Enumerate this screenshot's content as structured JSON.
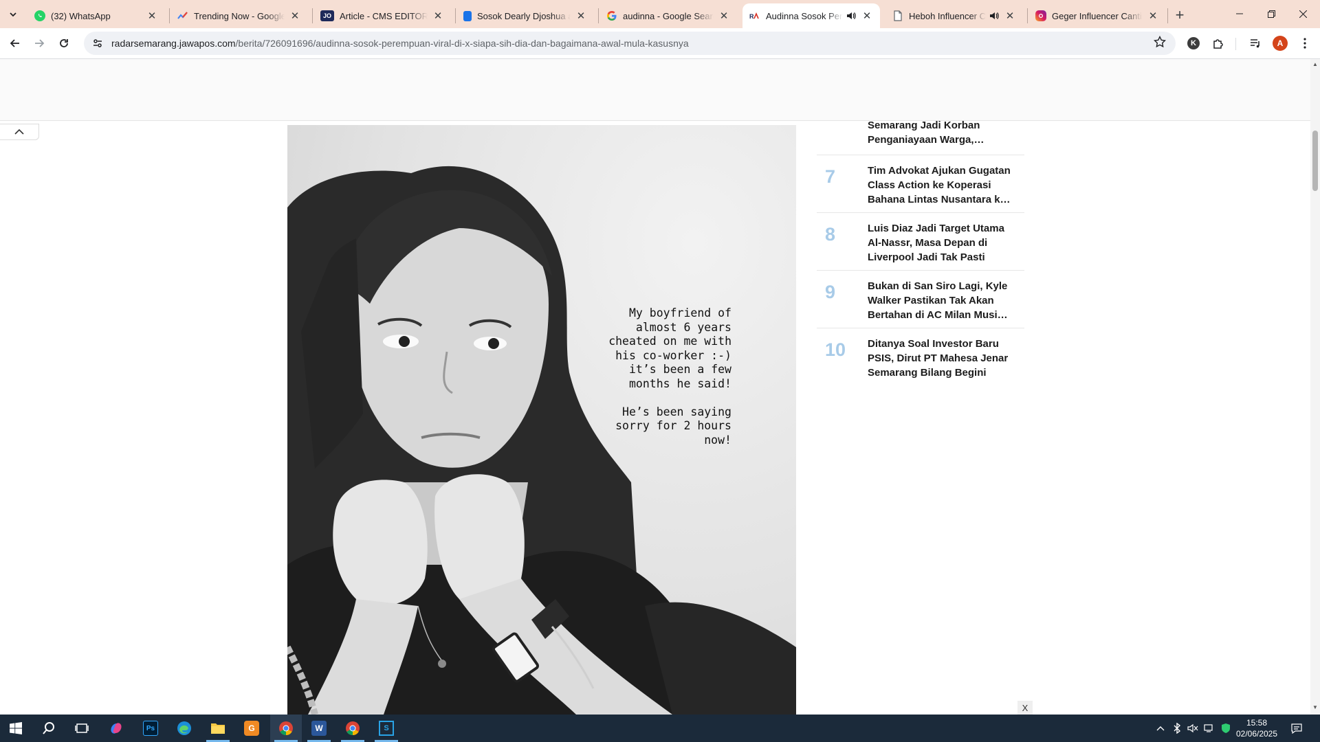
{
  "browser": {
    "tabs": [
      {
        "title": "(32) WhatsApp",
        "icon": "whatsapp-icon"
      },
      {
        "title": "Trending Now - Google Trends",
        "icon": "google-trends-icon"
      },
      {
        "title": "Article - CMS EDITOR",
        "icon": "cms-icon"
      },
      {
        "title": "Sosok Dearly Djoshua atau",
        "icon": "doc-icon"
      },
      {
        "title": "audinna - Google Search",
        "icon": "google-icon"
      },
      {
        "title": "Audinna Sosok Perempuan",
        "icon": "jawapos-icon",
        "active": true
      },
      {
        "title": "Heboh Influencer Cantik",
        "icon": "page-icon"
      },
      {
        "title": "Geger Influencer Cantik S",
        "icon": "instagram-icon"
      }
    ],
    "url_host": "radarsemarang.jawapos.com",
    "url_path": "/berita/726091696/audinna-sosok-perempuan-viral-di-x-siapa-sih-dia-dan-bagaimana-awal-mula-kasusnya",
    "profile_initial": "A",
    "extension_initial": "K"
  },
  "article": {
    "photo_caption_text": "My boyfriend of\nalmost 6 years\ncheated on me with\nhis co-worker :-)\nit’s been a few\nmonths he said!\n\nHe’s been saying\nsorry for 2 hours\nnow!"
  },
  "trending": [
    {
      "num": "",
      "title": "Semarang Jadi Korban Penganiayaan Warga,…"
    },
    {
      "num": "7",
      "title": "Tim Advokat Ajukan Gugatan Class Action ke Koperasi Bahana Lintas Nusantara k…"
    },
    {
      "num": "8",
      "title": "Luis Diaz Jadi Target Utama Al-Nassr, Masa Depan di Liverpool Jadi Tak Pasti"
    },
    {
      "num": "9",
      "title": "Bukan di San Siro Lagi, Kyle Walker Pastikan Tak Akan Bertahan di AC Milan Musi…"
    },
    {
      "num": "10",
      "title": "Ditanya Soal Investor Baru PSIS, Dirut PT Mahesa Jenar Semarang Bilang Begini"
    }
  ],
  "ad_close_label": "X",
  "taskbar": {
    "time": "15:58",
    "date": "02/06/2025"
  },
  "colors": {
    "tab_strip": "#f6dfd4",
    "trending_number": "#a8cbe8",
    "taskbar": "#1b2a3a"
  }
}
